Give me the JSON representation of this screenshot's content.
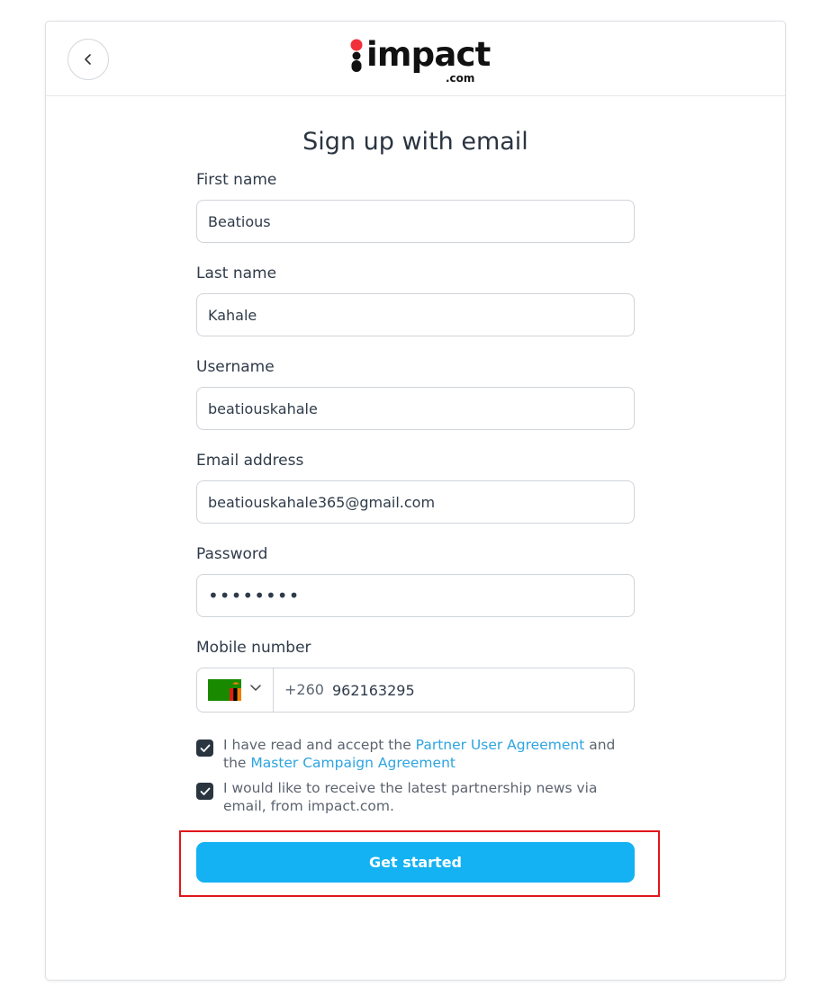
{
  "header": {
    "back_icon": "chevron-left-icon",
    "logo_text": "impact",
    "logo_suffix": ".com",
    "logo_colors": {
      "dot": "#f0303a",
      "ink": "#111111"
    }
  },
  "page_title": "Sign up with email",
  "fields": {
    "first_name": {
      "label": "First name",
      "value": "Beatious"
    },
    "last_name": {
      "label": "Last name",
      "value": "Kahale"
    },
    "username": {
      "label": "Username",
      "value": "beatiouskahale"
    },
    "email": {
      "label": "Email address",
      "value": "beatiouskahale365@gmail.com"
    },
    "password": {
      "label": "Password",
      "value": "••••••••"
    },
    "mobile": {
      "label": "Mobile number",
      "country_flag": "zambia-flag-icon",
      "dial_code": "+260",
      "value": "962163295"
    }
  },
  "consents": {
    "terms": {
      "checked": true,
      "text_1": "I have read and accept the ",
      "link_1": "Partner User Agreement",
      "text_2": " and the ",
      "link_2": "Master Campaign Agreement"
    },
    "news": {
      "checked": true,
      "text": "I would like to receive the latest partnership news via email, from impact.com."
    }
  },
  "submit_label": "Get started",
  "colors": {
    "accent": "#14b2f2",
    "link": "#2da4e0",
    "checkbox": "#2a3540",
    "highlight_box": "#e0161b"
  }
}
